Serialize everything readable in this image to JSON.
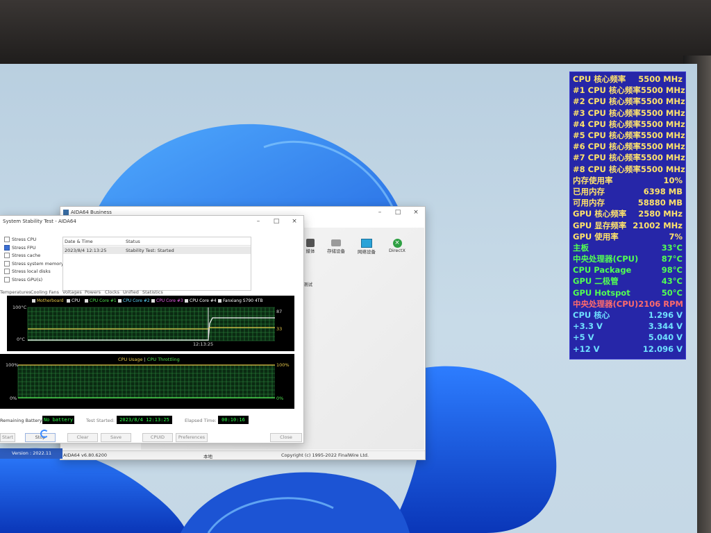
{
  "overlay": {
    "rows": [
      {
        "label": "CPU 核心频率",
        "value": "5500 MHz",
        "color": "#ffe36b"
      },
      {
        "label": "#1 CPU 核心频率",
        "value": "5500 MHz",
        "color": "#ffe36b"
      },
      {
        "label": "#2 CPU 核心频率",
        "value": "5500 MHz",
        "color": "#ffe36b"
      },
      {
        "label": "#3 CPU 核心频率",
        "value": "5500 MHz",
        "color": "#ffe36b"
      },
      {
        "label": "#4 CPU 核心频率",
        "value": "5500 MHz",
        "color": "#ffe36b"
      },
      {
        "label": "#5 CPU 核心频率",
        "value": "5500 MHz",
        "color": "#ffe36b"
      },
      {
        "label": "#6 CPU 核心频率",
        "value": "5500 MHz",
        "color": "#ffe36b"
      },
      {
        "label": "#7 CPU 核心频率",
        "value": "5500 MHz",
        "color": "#ffe36b"
      },
      {
        "label": "#8 CPU 核心频率",
        "value": "5500 MHz",
        "color": "#ffe36b"
      },
      {
        "label": "内存使用率",
        "value": "10%",
        "color": "#ffe36b"
      },
      {
        "label": "已用内存",
        "value": "6398 MB",
        "color": "#ffe36b"
      },
      {
        "label": "可用内存",
        "value": "58880 MB",
        "color": "#ffe36b"
      },
      {
        "label": "GPU 核心频率",
        "value": "2580 MHz",
        "color": "#ffe36b"
      },
      {
        "label": "GPU 显存频率",
        "value": "21002 MHz",
        "color": "#ffe36b"
      },
      {
        "label": "GPU 使用率",
        "value": "7%",
        "color": "#ffe36b"
      },
      {
        "label": "主板",
        "value": "33°C",
        "color": "#52ff52"
      },
      {
        "label": "中央处理器(CPU)",
        "value": "87°C",
        "color": "#52ff52"
      },
      {
        "label": "CPU Package",
        "value": "98°C",
        "color": "#52ff52"
      },
      {
        "label": "GPU 二极管",
        "value": "43°C",
        "color": "#52ff52"
      },
      {
        "label": "GPU Hotspot",
        "value": "50°C",
        "color": "#52ff52"
      },
      {
        "label": "中央处理器(CPU)",
        "value": "2106 RPM",
        "color": "#ff6b6b"
      },
      {
        "label": "CPU 核心",
        "value": "1.296 V",
        "color": "#6fe0ff"
      },
      {
        "label": "+3.3 V",
        "value": "3.344 V",
        "color": "#6fe0ff"
      },
      {
        "label": "+5 V",
        "value": "5.040 V",
        "color": "#6fe0ff"
      },
      {
        "label": "+12 V",
        "value": "12.096 V",
        "color": "#6fe0ff"
      }
    ]
  },
  "main_window": {
    "title": "AIDA64 Business",
    "icons": [
      {
        "label": "媒体",
        "icon": "media-icon"
      },
      {
        "label": "存储设备",
        "icon": "storage-icon"
      },
      {
        "label": "网络设备",
        "icon": "network-icon"
      },
      {
        "label": "DirectX",
        "icon": "xbox-icon"
      }
    ],
    "partial_label": "测试",
    "status_left": "AIDA64 v6.80.6200",
    "status_mid": "本地",
    "status_right": "Copyright (c) 1995-2022 FinalWire Ltd.",
    "version": "Version : 2022.11"
  },
  "stability": {
    "title": "System Stability Test - AIDA64",
    "options": [
      {
        "label": "Stress CPU",
        "checked": false
      },
      {
        "label": "Stress FPU",
        "checked": true
      },
      {
        "label": "Stress cache",
        "checked": false
      },
      {
        "label": "Stress system memory",
        "checked": false
      },
      {
        "label": "Stress local disks",
        "checked": false
      },
      {
        "label": "Stress GPU(s)",
        "checked": false
      }
    ],
    "log_headers": [
      "Date & Time",
      "Status"
    ],
    "log_rows": [
      [
        "2023/8/4 12:13:25",
        "Stability Test: Started"
      ]
    ],
    "tabs": [
      "Temperatures",
      "Cooling Fans",
      "Voltages",
      "Powers",
      "Clocks",
      "Unified",
      "Statistics"
    ],
    "temp_legend": [
      {
        "label": "Motherboard",
        "color": "#e6c84a"
      },
      {
        "label": "CPU",
        "color": "#ffffff"
      },
      {
        "label": "CPU Core #1",
        "color": "#4fe04f"
      },
      {
        "label": "CPU Core #2",
        "color": "#5fd8ff"
      },
      {
        "label": "CPU Core #3",
        "color": "#e85fe8"
      },
      {
        "label": "CPU Core #4",
        "color": "#ffffff"
      },
      {
        "label": "Fanxiang S790 4TB",
        "color": "#ffffff"
      }
    ],
    "temp_chart": {
      "ymax_label": "100°C",
      "ymin_label": "0°C",
      "time_label": "12:13:25",
      "right_top": "87",
      "right_bottom": "33"
    },
    "usage_chart": {
      "title_left": "CPU Usage",
      "sep": "|",
      "title_right": "CPU Throttling",
      "left_top": "100%",
      "left_bottom": "0%",
      "right_top": "100%",
      "right_bottom": "0%"
    },
    "battery_label": "Remaining Battery:",
    "battery_value": "No battery",
    "started_label": "Test Started:",
    "started_value": "2023/8/4 12:13:25",
    "elapsed_label": "Elapsed Time:",
    "elapsed_value": "00:10:16",
    "buttons": [
      "Start",
      "Stop",
      "Clear",
      "Save",
      "CPUID",
      "Preferences",
      "Close"
    ]
  }
}
